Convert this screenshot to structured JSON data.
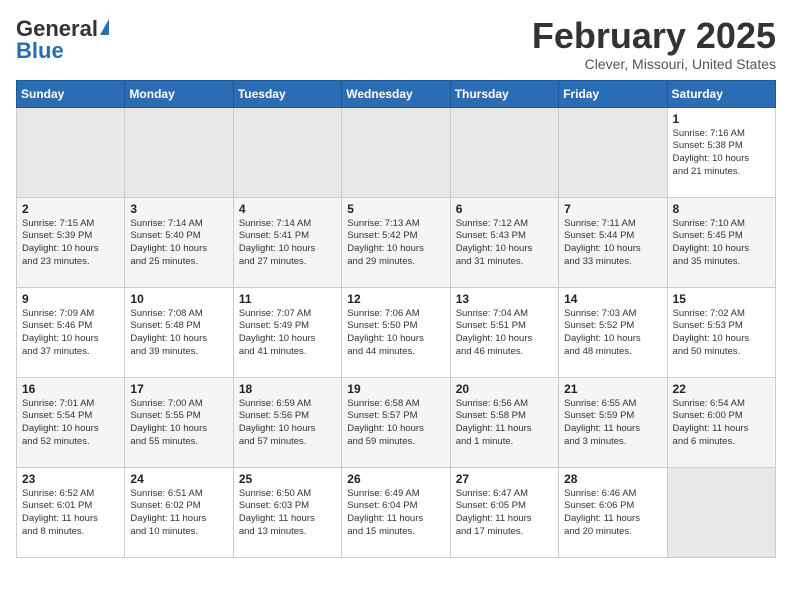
{
  "header": {
    "logo_general": "General",
    "logo_blue": "Blue",
    "month_title": "February 2025",
    "location": "Clever, Missouri, United States"
  },
  "weekdays": [
    "Sunday",
    "Monday",
    "Tuesday",
    "Wednesday",
    "Thursday",
    "Friday",
    "Saturday"
  ],
  "weeks": [
    [
      {
        "day": "",
        "info": ""
      },
      {
        "day": "",
        "info": ""
      },
      {
        "day": "",
        "info": ""
      },
      {
        "day": "",
        "info": ""
      },
      {
        "day": "",
        "info": ""
      },
      {
        "day": "",
        "info": ""
      },
      {
        "day": "1",
        "info": "Sunrise: 7:16 AM\nSunset: 5:38 PM\nDaylight: 10 hours\nand 21 minutes."
      }
    ],
    [
      {
        "day": "2",
        "info": "Sunrise: 7:15 AM\nSunset: 5:39 PM\nDaylight: 10 hours\nand 23 minutes."
      },
      {
        "day": "3",
        "info": "Sunrise: 7:14 AM\nSunset: 5:40 PM\nDaylight: 10 hours\nand 25 minutes."
      },
      {
        "day": "4",
        "info": "Sunrise: 7:14 AM\nSunset: 5:41 PM\nDaylight: 10 hours\nand 27 minutes."
      },
      {
        "day": "5",
        "info": "Sunrise: 7:13 AM\nSunset: 5:42 PM\nDaylight: 10 hours\nand 29 minutes."
      },
      {
        "day": "6",
        "info": "Sunrise: 7:12 AM\nSunset: 5:43 PM\nDaylight: 10 hours\nand 31 minutes."
      },
      {
        "day": "7",
        "info": "Sunrise: 7:11 AM\nSunset: 5:44 PM\nDaylight: 10 hours\nand 33 minutes."
      },
      {
        "day": "8",
        "info": "Sunrise: 7:10 AM\nSunset: 5:45 PM\nDaylight: 10 hours\nand 35 minutes."
      }
    ],
    [
      {
        "day": "9",
        "info": "Sunrise: 7:09 AM\nSunset: 5:46 PM\nDaylight: 10 hours\nand 37 minutes."
      },
      {
        "day": "10",
        "info": "Sunrise: 7:08 AM\nSunset: 5:48 PM\nDaylight: 10 hours\nand 39 minutes."
      },
      {
        "day": "11",
        "info": "Sunrise: 7:07 AM\nSunset: 5:49 PM\nDaylight: 10 hours\nand 41 minutes."
      },
      {
        "day": "12",
        "info": "Sunrise: 7:06 AM\nSunset: 5:50 PM\nDaylight: 10 hours\nand 44 minutes."
      },
      {
        "day": "13",
        "info": "Sunrise: 7:04 AM\nSunset: 5:51 PM\nDaylight: 10 hours\nand 46 minutes."
      },
      {
        "day": "14",
        "info": "Sunrise: 7:03 AM\nSunset: 5:52 PM\nDaylight: 10 hours\nand 48 minutes."
      },
      {
        "day": "15",
        "info": "Sunrise: 7:02 AM\nSunset: 5:53 PM\nDaylight: 10 hours\nand 50 minutes."
      }
    ],
    [
      {
        "day": "16",
        "info": "Sunrise: 7:01 AM\nSunset: 5:54 PM\nDaylight: 10 hours\nand 52 minutes."
      },
      {
        "day": "17",
        "info": "Sunrise: 7:00 AM\nSunset: 5:55 PM\nDaylight: 10 hours\nand 55 minutes."
      },
      {
        "day": "18",
        "info": "Sunrise: 6:59 AM\nSunset: 5:56 PM\nDaylight: 10 hours\nand 57 minutes."
      },
      {
        "day": "19",
        "info": "Sunrise: 6:58 AM\nSunset: 5:57 PM\nDaylight: 10 hours\nand 59 minutes."
      },
      {
        "day": "20",
        "info": "Sunrise: 6:56 AM\nSunset: 5:58 PM\nDaylight: 11 hours\nand 1 minute."
      },
      {
        "day": "21",
        "info": "Sunrise: 6:55 AM\nSunset: 5:59 PM\nDaylight: 11 hours\nand 3 minutes."
      },
      {
        "day": "22",
        "info": "Sunrise: 6:54 AM\nSunset: 6:00 PM\nDaylight: 11 hours\nand 6 minutes."
      }
    ],
    [
      {
        "day": "23",
        "info": "Sunrise: 6:52 AM\nSunset: 6:01 PM\nDaylight: 11 hours\nand 8 minutes."
      },
      {
        "day": "24",
        "info": "Sunrise: 6:51 AM\nSunset: 6:02 PM\nDaylight: 11 hours\nand 10 minutes."
      },
      {
        "day": "25",
        "info": "Sunrise: 6:50 AM\nSunset: 6:03 PM\nDaylight: 11 hours\nand 13 minutes."
      },
      {
        "day": "26",
        "info": "Sunrise: 6:49 AM\nSunset: 6:04 PM\nDaylight: 11 hours\nand 15 minutes."
      },
      {
        "day": "27",
        "info": "Sunrise: 6:47 AM\nSunset: 6:05 PM\nDaylight: 11 hours\nand 17 minutes."
      },
      {
        "day": "28",
        "info": "Sunrise: 6:46 AM\nSunset: 6:06 PM\nDaylight: 11 hours\nand 20 minutes."
      },
      {
        "day": "",
        "info": ""
      }
    ]
  ]
}
